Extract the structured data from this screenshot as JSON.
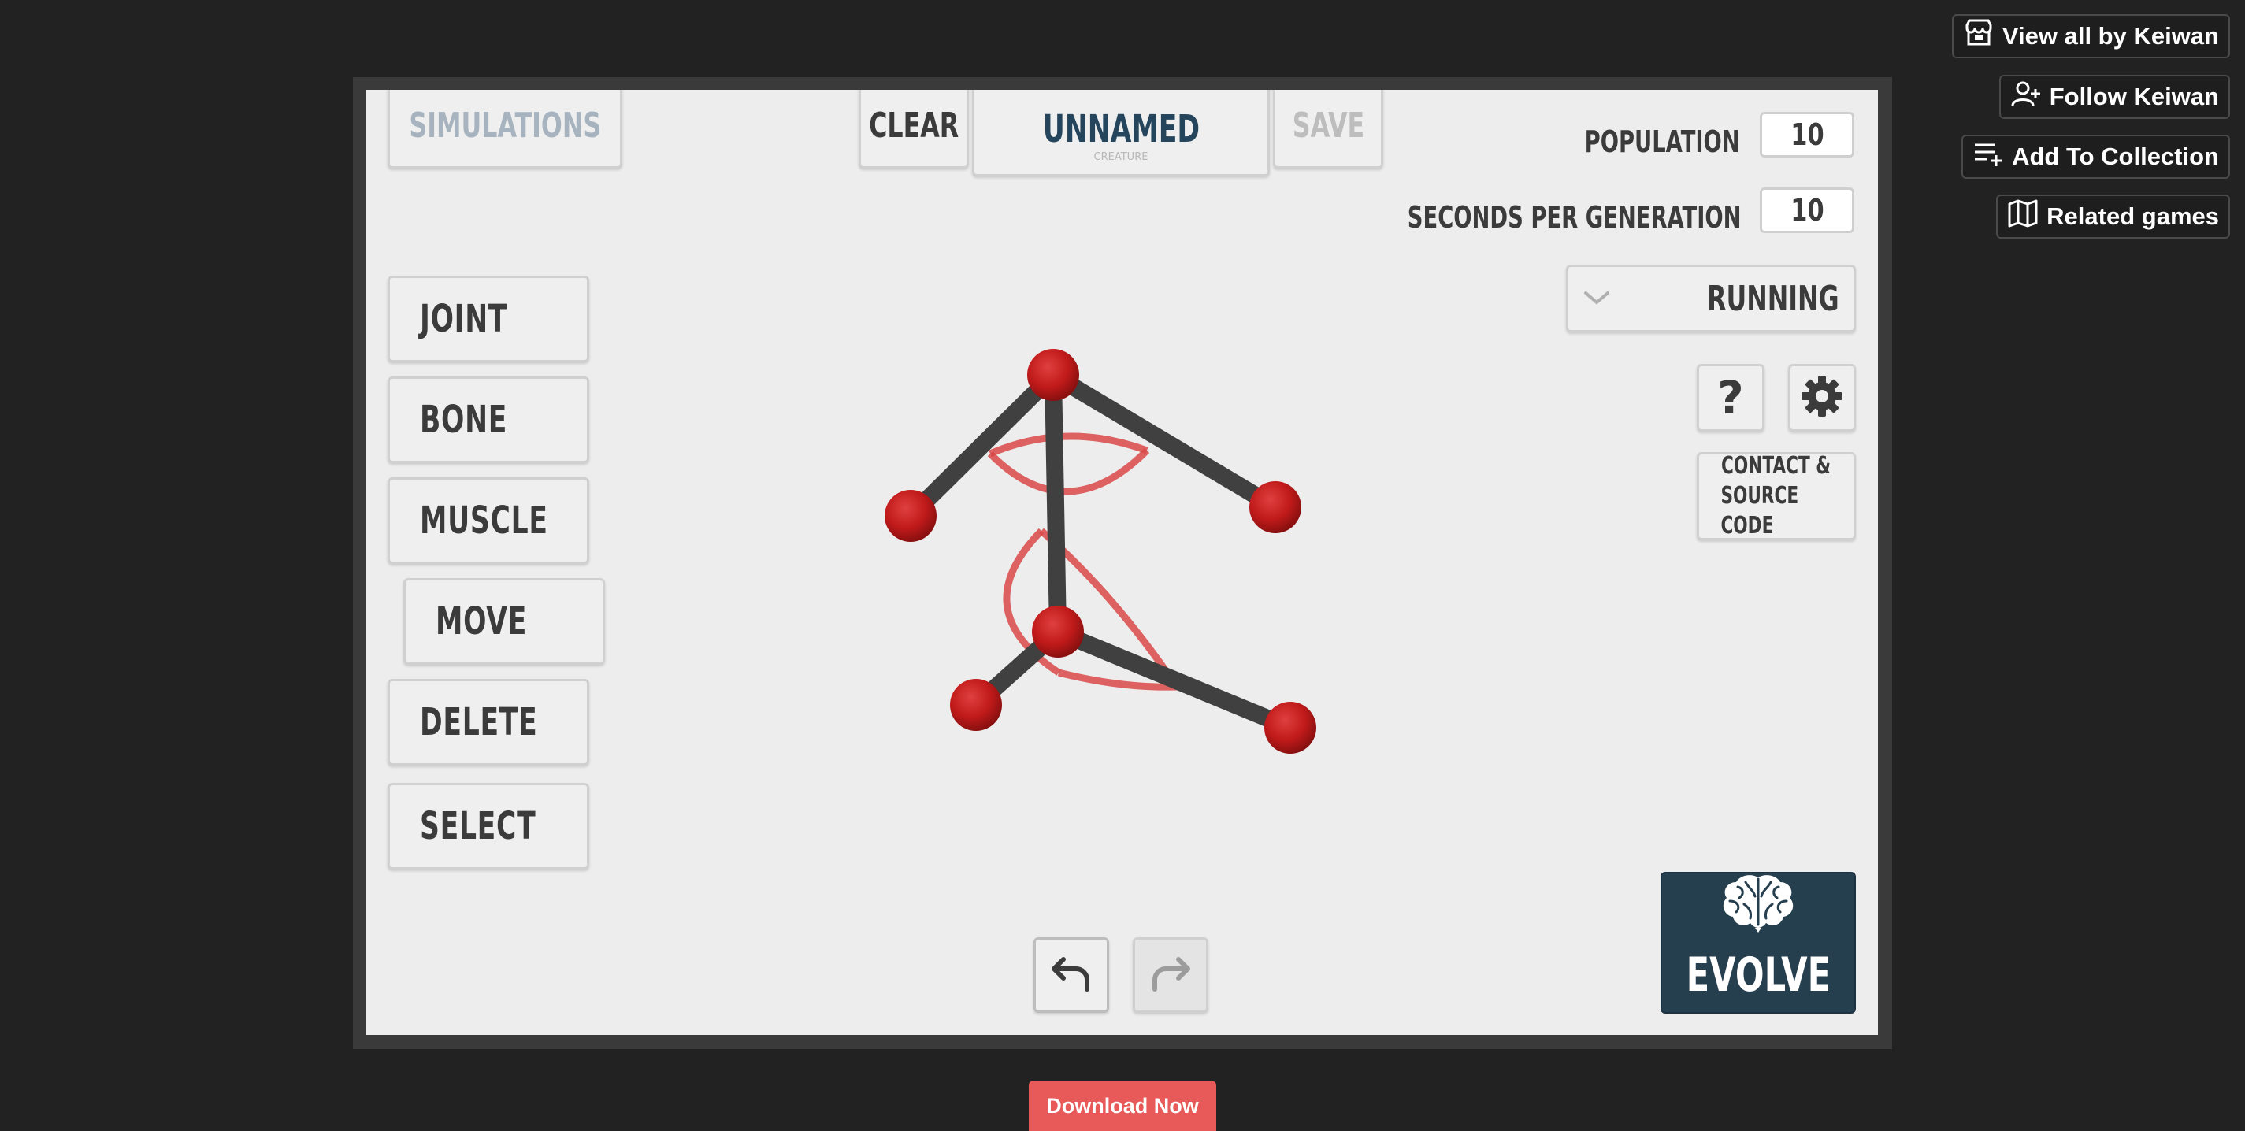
{
  "sidebar_links": [
    {
      "label": "View all by Keiwan",
      "icon": "store-icon"
    },
    {
      "label": "Follow Keiwan",
      "icon": "follow-user-icon"
    },
    {
      "label": "Add To Collection",
      "icon": "add-to-list-icon"
    },
    {
      "label": "Related games",
      "icon": "map-icon"
    }
  ],
  "game": {
    "simulations_label": "SIMULATIONS",
    "clear_label": "CLEAR",
    "creature_name": "UNNAMED",
    "creature_sublabel": "CREATURE",
    "save_label": "SAVE",
    "population_label": "POPULATION",
    "population_value": "10",
    "seconds_label": "SECONDS PER GENERATION",
    "seconds_value": "10",
    "task_selected": "RUNNING",
    "help_label": "?",
    "contact_line1": "CONTACT &",
    "contact_line2": "SOURCE CODE",
    "tools": [
      "JOINT",
      "BONE",
      "MUSCLE",
      "MOVE",
      "DELETE",
      "SELECT"
    ],
    "active_tool": "MOVE",
    "evolve_label": "EVOLVE",
    "icons": {
      "undo": "undo-icon",
      "redo": "redo-icon",
      "settings": "gear-icon",
      "dropdown": "chevron-down-icon",
      "evolve": "brain-icon"
    },
    "colors": {
      "canvas": "#ededed",
      "joint": "#c41c1c",
      "bone": "#404040",
      "muscle": "#d94848",
      "evolve_bg": "#263f4f",
      "download": "#e85a5a"
    }
  },
  "download_label": "Download Now"
}
